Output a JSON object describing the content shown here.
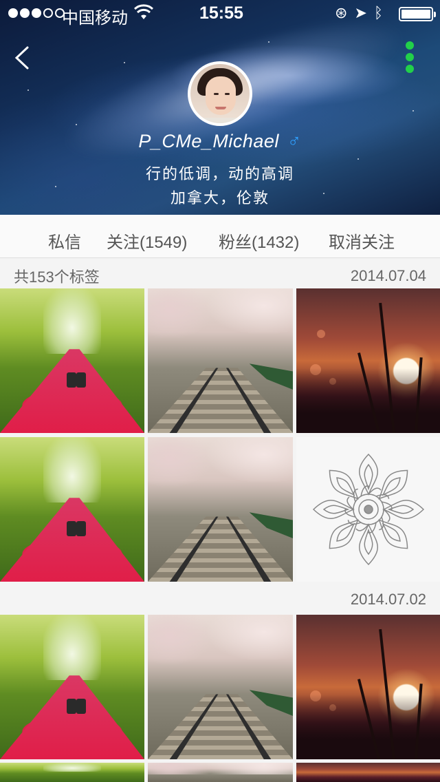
{
  "status_bar": {
    "carrier": "中国移动",
    "time": "15:55",
    "wifi_icon": "wifi-icon",
    "icons": [
      "lock-rotation-icon",
      "location-icon",
      "bluetooth-icon",
      "battery-icon"
    ]
  },
  "profile": {
    "username": "P_CMe_Michael",
    "gender_symbol": "♂",
    "bio_line1": "行的低调，动的高调",
    "bio_line2": "加拿大，伦敦"
  },
  "actions": {
    "message": "私信",
    "following": "关注(1549)",
    "followers": "粉丝(1432)",
    "unfollow": "取消关注"
  },
  "tags": {
    "count_label": "共153个标签"
  },
  "sections": [
    {
      "date": "2014.07.04",
      "photos": [
        "forest-path",
        "cherry-railway",
        "sunset-reeds",
        "forest-path",
        "cherry-railway",
        "mandala"
      ]
    },
    {
      "date": "2014.07.02",
      "photos": [
        "forest-path",
        "cherry-railway",
        "sunset-reeds"
      ]
    }
  ],
  "colors": {
    "more_dots": "#22d04a",
    "gender": "#2fa0ff",
    "bar_bg": "#fafafa"
  }
}
